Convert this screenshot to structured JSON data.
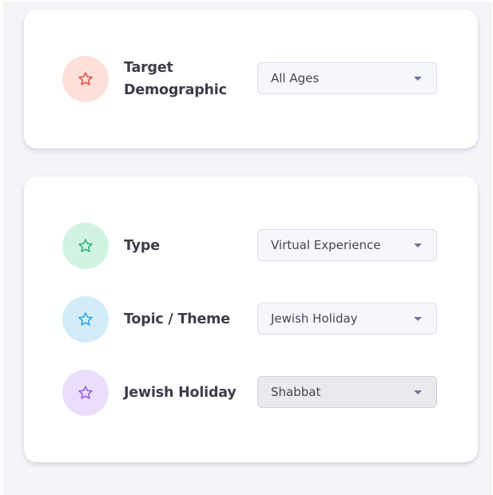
{
  "sections": {
    "demographic": {
      "label": "Target Demographic",
      "value": "All Ages",
      "icon": "star-icon",
      "icon_color": "#e5574d",
      "icon_bg": "#fde0da"
    },
    "details": {
      "type": {
        "label": "Type",
        "value": "Virtual Experience",
        "icon": "star-icon",
        "icon_color": "#32b878",
        "icon_bg": "#d3f3e2"
      },
      "topic": {
        "label": "Topic / Theme",
        "value": "Jewish Holiday",
        "icon": "star-icon",
        "icon_color": "#3aa6e0",
        "icon_bg": "#d2ecf9"
      },
      "holiday": {
        "label": "Jewish Holiday",
        "value": "Shabbat",
        "icon": "star-icon",
        "icon_color": "#9b62e8",
        "icon_bg": "#ebdefc",
        "disabled": true
      }
    }
  }
}
